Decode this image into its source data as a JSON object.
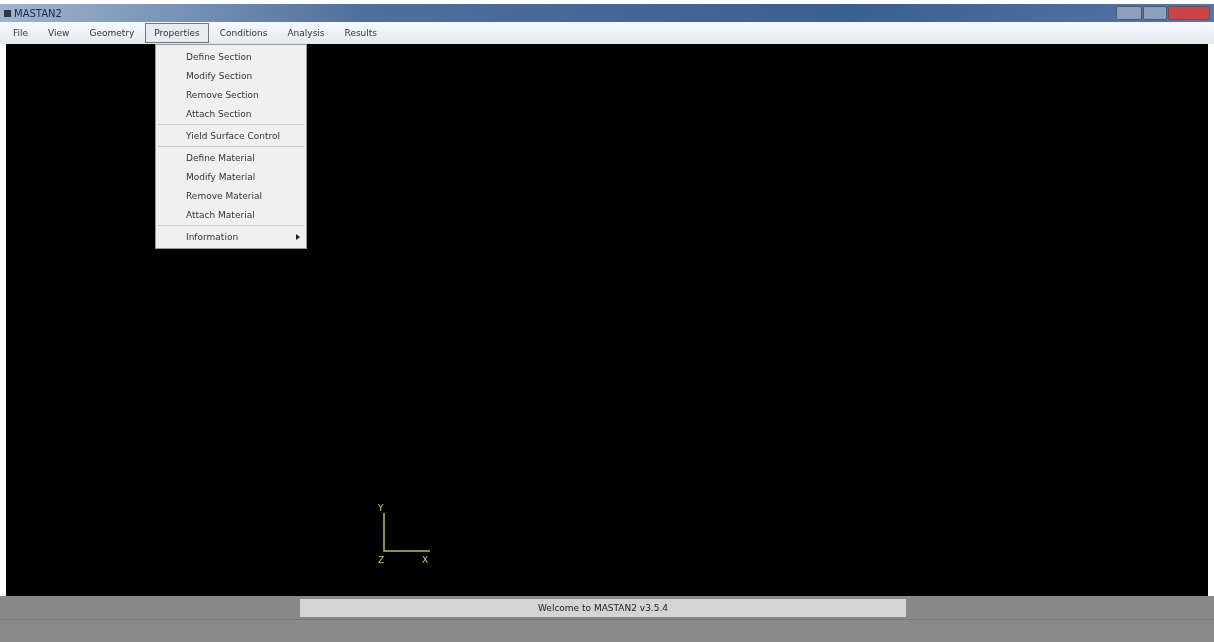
{
  "window": {
    "title": "MASTAN2"
  },
  "menu_bar": [
    {
      "label": "File",
      "selected": false
    },
    {
      "label": "View",
      "selected": false
    },
    {
      "label": "Geometry",
      "selected": false
    },
    {
      "label": "Properties",
      "selected": true
    },
    {
      "label": "Conditions",
      "selected": false
    },
    {
      "label": "Analysis",
      "selected": false
    },
    {
      "label": "Results",
      "selected": false
    }
  ],
  "dropdown": {
    "groups": [
      [
        {
          "label": "Define Section",
          "has_submenu": false
        },
        {
          "label": "Modify Section",
          "has_submenu": false
        },
        {
          "label": "Remove Section",
          "has_submenu": false
        },
        {
          "label": "Attach Section",
          "has_submenu": false
        }
      ],
      [
        {
          "label": "Yield Surface Control",
          "has_submenu": false
        }
      ],
      [
        {
          "label": "Define Material",
          "has_submenu": false
        },
        {
          "label": "Modify Material",
          "has_submenu": false
        },
        {
          "label": "Remove Material",
          "has_submenu": false
        },
        {
          "label": "Attach Material",
          "has_submenu": false
        }
      ],
      [
        {
          "label": "Information",
          "has_submenu": true
        }
      ]
    ]
  },
  "axes": {
    "y": "Y",
    "z": "Z",
    "x": "X"
  },
  "status_bar": {
    "message": "Welcome to MASTAN2 v3.5.4"
  }
}
